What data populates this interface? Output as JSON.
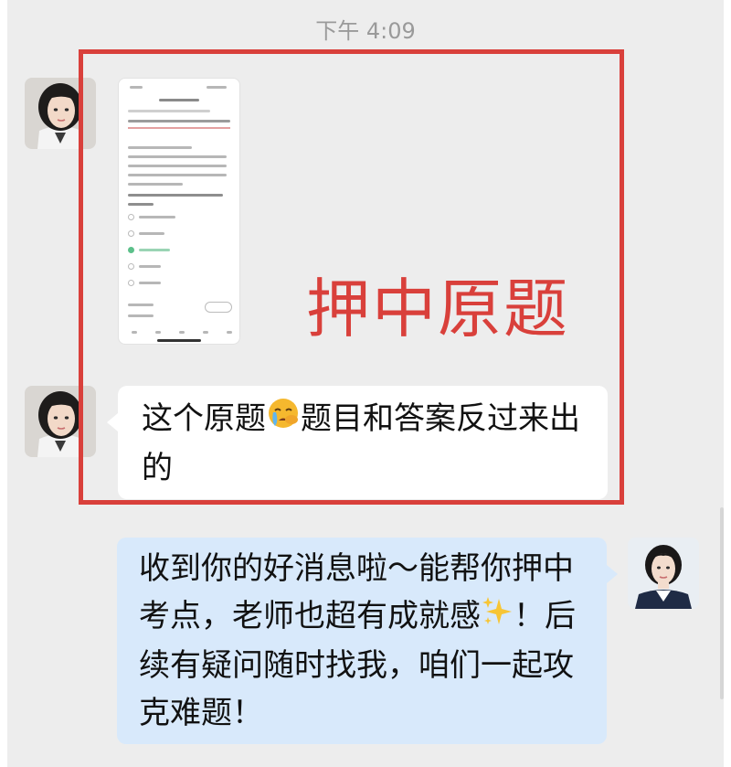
{
  "timestamp": "下午 4:09",
  "messages": {
    "received_image_alt": "题目截图",
    "received_text_a": "这个原题",
    "received_text_b": "题目和答案反过来出的",
    "sent_text_a": "收到你的好消息啦～能帮你押中考点，老师也超有成就感",
    "sent_text_b": "！后续有疑问随时找我，咱们一起攻克难题！"
  },
  "annotation": {
    "stamp": "押中原题"
  },
  "icons": {
    "left_avatar": "teacher-avatar-icon",
    "right_avatar": "user-avatar-icon",
    "crying_emoji": "crying-face-emoji-icon",
    "sparkles_emoji": "sparkles-emoji-icon"
  },
  "colors": {
    "chat_background": "#ededed",
    "received_bubble": "#ffffff",
    "sent_bubble": "#d8e9fb",
    "annotation_red": "#d9403b"
  }
}
